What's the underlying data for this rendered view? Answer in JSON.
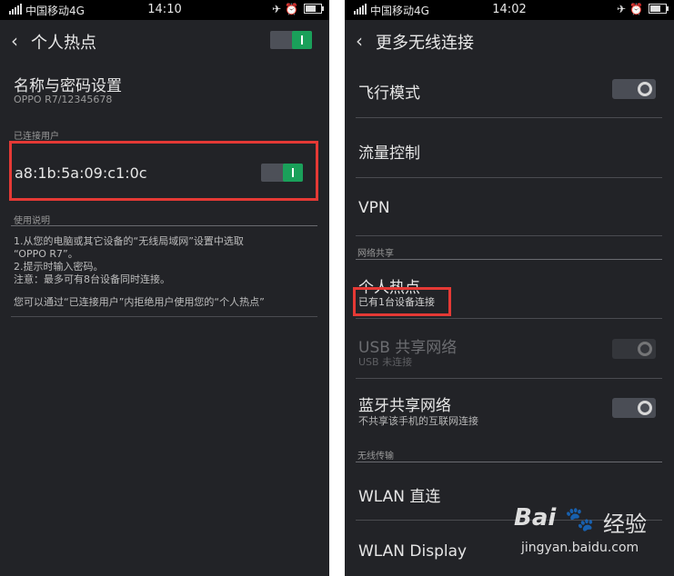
{
  "statusbar": {
    "carrier": "中国移动4G"
  },
  "left": {
    "time": "14:10",
    "title": "个人热点",
    "name_pw_title": "名称与密码设置",
    "name_pw_sub": "OPPO R7/12345678",
    "connected_section": "已连接用户",
    "connected_mac": "a8:1b:5a:09:c1:0c",
    "usage_section": "使用说明",
    "usage_lines": [
      "1.从您的电脑或其它设备的“无线局域网”设置中选取",
      "“OPPO R7”。",
      "2.提示时输入密码。",
      "注意：最多可有8台设备同时连接。",
      "您可以通过“已连接用户”内拒绝用户使用您的“个人热点”"
    ],
    "toggles": {
      "hotspot": true,
      "user": true
    }
  },
  "right": {
    "time": "14:02",
    "title": "更多无线连接",
    "airplane": "飞行模式",
    "traffic": "流量控制",
    "vpn": "VPN",
    "net_share_section": "网络共享",
    "hotspot_title": "个人热点",
    "hotspot_sub": "已有1台设备连接",
    "usb_title": "USB 共享网络",
    "usb_sub": "USB 未连接",
    "bt_title": "蓝牙共享网络",
    "bt_sub": "不共享该手机的互联网连接",
    "wireless_section": "无线传输",
    "wlan_direct": "WLAN 直连",
    "wlan_display": "WLAN Display",
    "toggles": {
      "airplane": false,
      "usb": false,
      "bluetooth": false
    }
  },
  "watermark": {
    "brand": "Bai",
    "brand_cn": "经验",
    "url": "jingyan.baidu.com"
  },
  "colors": {
    "accent_green": "#1aa05a",
    "highlight_red": "#e53935",
    "background": "#222327"
  }
}
